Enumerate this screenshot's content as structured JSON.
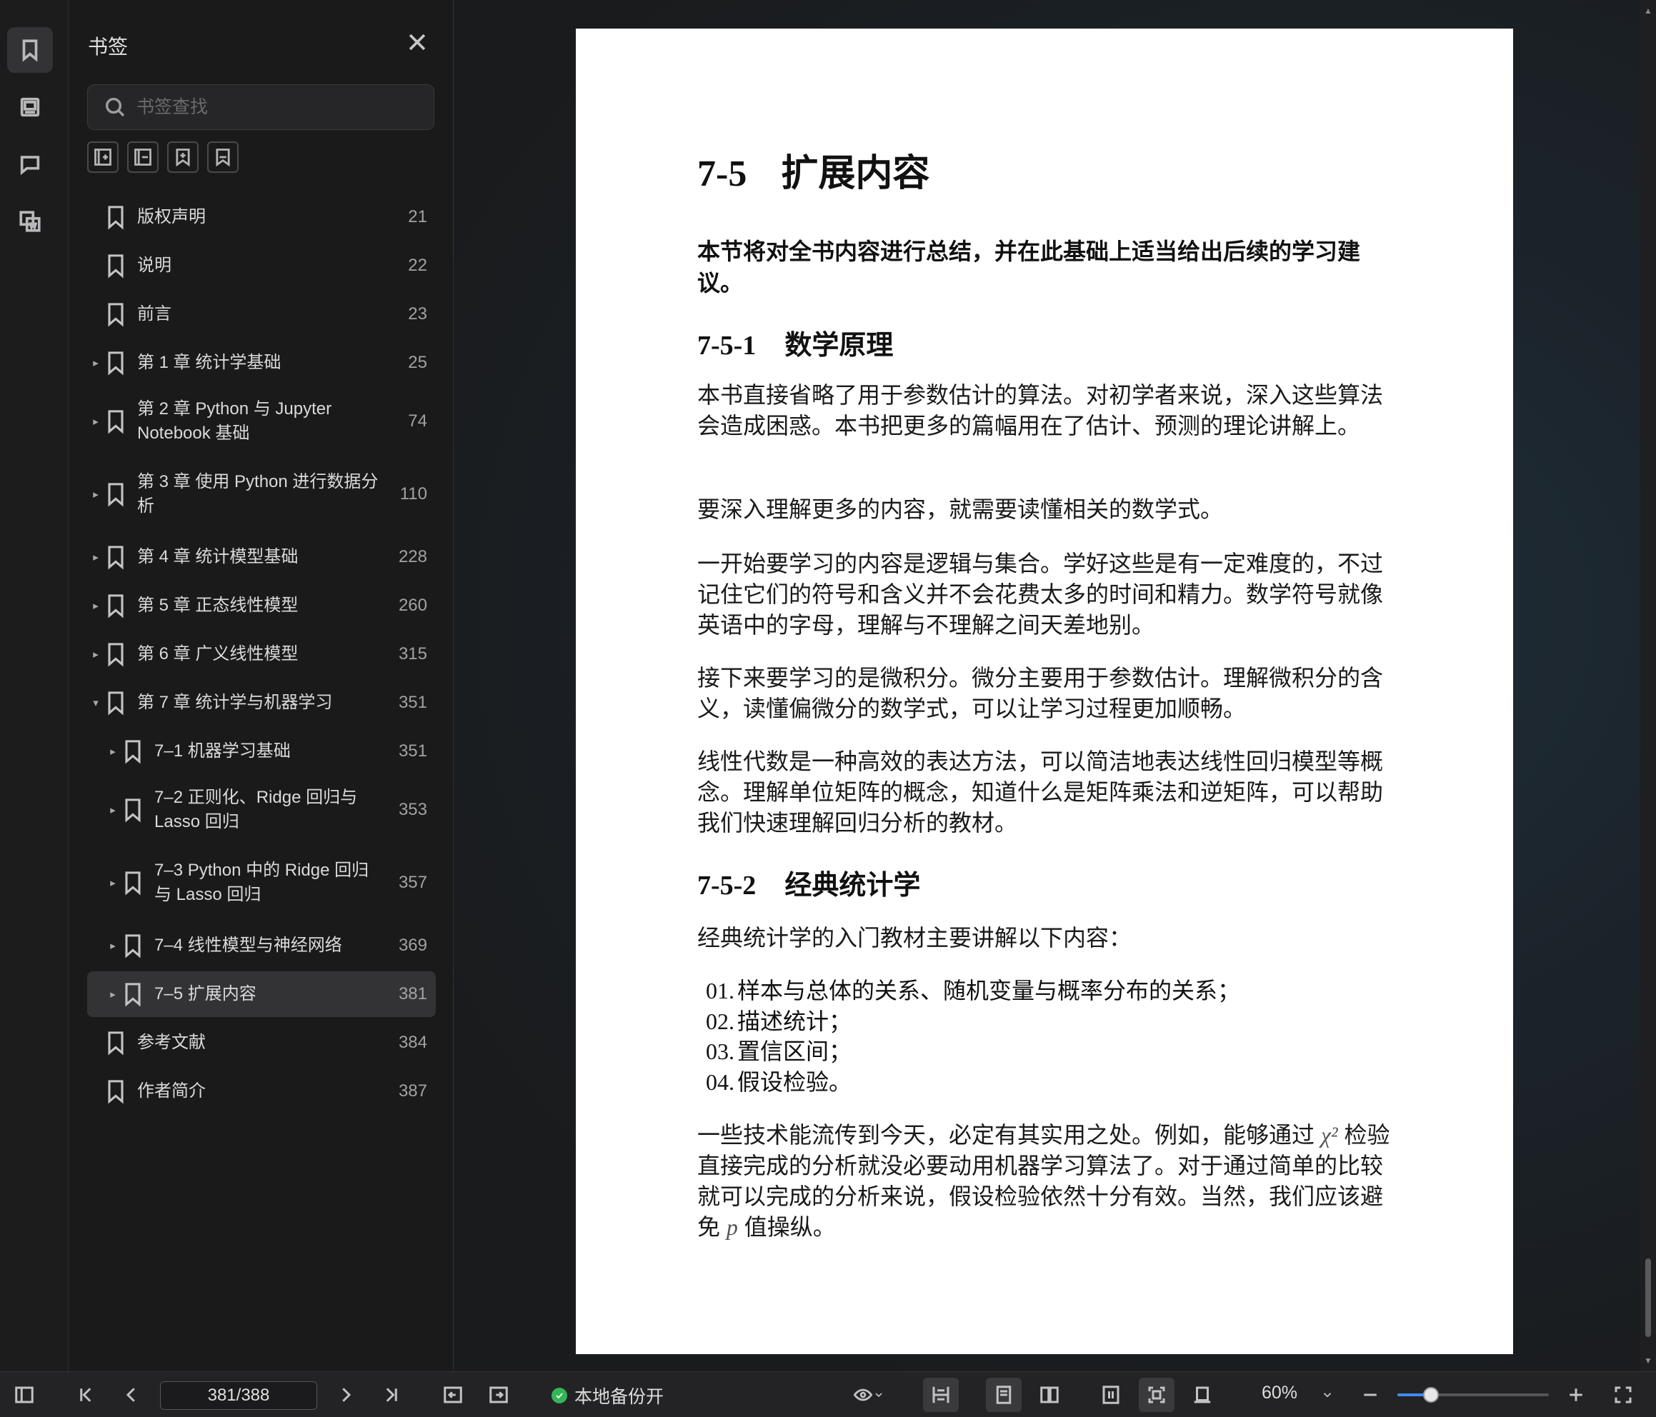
{
  "sidebar": {
    "title": "书签",
    "search_placeholder": "书签查找",
    "rail_icons": [
      "bookmark-icon",
      "image-icon",
      "comment-icon",
      "thumbnail-icon"
    ],
    "tool_icons": [
      "expand-all-icon",
      "collapse-all-icon",
      "add-bookmark-icon",
      "bookmark-outline-icon"
    ],
    "items": [
      {
        "label": "版权声明",
        "page": "21",
        "level": 0,
        "caret": ""
      },
      {
        "label": "说明",
        "page": "22",
        "level": 0,
        "caret": ""
      },
      {
        "label": "前言",
        "page": "23",
        "level": 0,
        "caret": ""
      },
      {
        "label": "第 1 章 统计学基础",
        "page": "25",
        "level": 0,
        "caret": "▸"
      },
      {
        "label": "第 2 章 Python 与 Jupyter Notebook 基础",
        "page": "74",
        "level": 0,
        "caret": "▸"
      },
      {
        "label": "第 3 章 使用 Python 进行数据分析",
        "page": "110",
        "level": 0,
        "caret": "▸"
      },
      {
        "label": "第 4 章 统计模型基础",
        "page": "228",
        "level": 0,
        "caret": "▸"
      },
      {
        "label": "第 5 章 正态线性模型",
        "page": "260",
        "level": 0,
        "caret": "▸"
      },
      {
        "label": "第 6 章 广义线性模型",
        "page": "315",
        "level": 0,
        "caret": "▸"
      },
      {
        "label": "第 7 章 统计学与机器学习",
        "page": "351",
        "level": 0,
        "caret": "▾"
      },
      {
        "label": "7–1 机器学习基础",
        "page": "351",
        "level": 1,
        "caret": "▸"
      },
      {
        "label": "7–2 正则化、Ridge 回归与 Lasso 回归",
        "page": "353",
        "level": 1,
        "caret": "▸"
      },
      {
        "label": "7–3 Python 中的 Ridge 回归与 Lasso 回归",
        "page": "357",
        "level": 1,
        "caret": "▸"
      },
      {
        "label": "7–4 线性模型与神经网络",
        "page": "369",
        "level": 1,
        "caret": "▸"
      },
      {
        "label": "7–5 扩展内容",
        "page": "381",
        "level": 1,
        "caret": "▸",
        "selected": true
      },
      {
        "label": "参考文献",
        "page": "384",
        "level": 0,
        "caret": ""
      },
      {
        "label": "作者简介",
        "page": "387",
        "level": 0,
        "caret": ""
      }
    ]
  },
  "document": {
    "h1_num": "7-5",
    "h1_title": "扩展内容",
    "lead": "本节将对全书内容进行总结，并在此基础上适当给出后续的学习建议。",
    "s1_num": "7-5-1",
    "s1_title": "数学原理",
    "p1": "本书直接省略了用于参数估计的算法。对初学者来说，深入这些算法会造成困惑。本书把更多的篇幅用在了估计、预测的理论讲解上。",
    "p2": "要深入理解更多的内容，就需要读懂相关的数学式。",
    "p3": "一开始要学习的内容是逻辑与集合。学好这些是有一定难度的，不过记住它们的符号和含义并不会花费太多的时间和精力。数学符号就像英语中的字母，理解与不理解之间天差地别。",
    "p4": "接下来要学习的是微积分。微分主要用于参数估计。理解微积分的含义，读懂偏微分的数学式，可以让学习过程更加顺畅。",
    "p5": "线性代数是一种高效的表达方法，可以简洁地表达线性回归模型等概念。理解单位矩阵的概念，知道什么是矩阵乘法和逆矩阵，可以帮助我们快速理解回归分析的教材。",
    "s2_num": "7-5-2",
    "s2_title": "经典统计学",
    "p6": "经典统计学的入门教材主要讲解以下内容：",
    "list": [
      {
        "n": "01.",
        "t": "样本与总体的关系、随机变量与概率分布的关系；"
      },
      {
        "n": "02.",
        "t": "描述统计；"
      },
      {
        "n": "03.",
        "t": "置信区间；"
      },
      {
        "n": "04.",
        "t": "假设检验。"
      }
    ],
    "p7_a": "一些技术能流传到今天，必定有其实用之处。例如，能够通过 ",
    "p7_chi": "χ²",
    "p7_b": " 检验直接完成的分析就没必要动用机器学习算法了。对于通过简单的比较就可以完成的分析来说，假设检验依然十分有效。当然，我们应该避免 ",
    "p7_p": "p",
    "p7_c": " 值操纵。"
  },
  "statusbar": {
    "page_indicator": "381/388",
    "backup_label": "本地备份开",
    "zoom_label": "60%",
    "zoom_fraction": 0.22
  }
}
